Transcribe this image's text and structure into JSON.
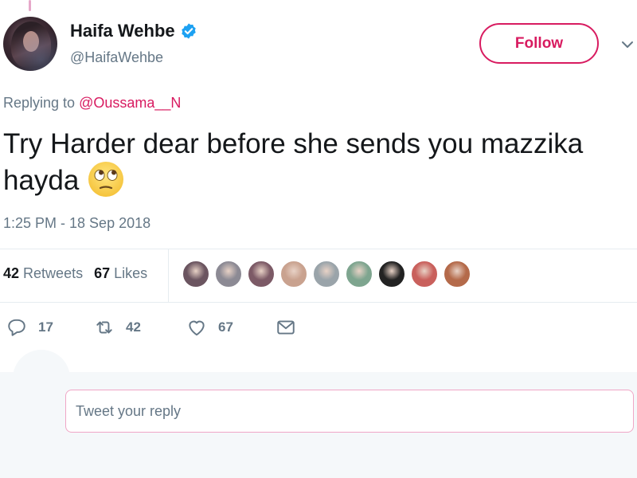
{
  "author": {
    "display_name": "Haifa Wehbe",
    "handle": "@HaifaWehbe",
    "verified": true
  },
  "follow_button": {
    "label": "Follow"
  },
  "reply_context": {
    "prefix": "Replying to ",
    "mention": "@Oussama__N"
  },
  "tweet": {
    "text": "Try Harder dear before she sends you mazzika hayda",
    "emoji": "face-with-rolling-eyes",
    "timestamp": "1:25 PM - 18 Sep 2018"
  },
  "stats": {
    "retweets_count": "42",
    "retweets_label": "Retweets",
    "likes_count": "67",
    "likes_label": "Likes"
  },
  "liker_avatars": [
    {
      "color": "#6b5560"
    },
    {
      "color": "#8c8a94"
    },
    {
      "color": "#7c5a66"
    },
    {
      "color": "#c9a28f"
    },
    {
      "color": "#9aa4aa"
    },
    {
      "color": "#7ea58f"
    },
    {
      "color": "#222222"
    },
    {
      "color": "#c9605c"
    },
    {
      "color": "#b46a4a"
    }
  ],
  "actions": {
    "reply_count": "17",
    "retweet_count": "42",
    "like_count": "67"
  },
  "reply_box": {
    "placeholder": "Tweet your reply"
  },
  "colors": {
    "accent": "#d81b60",
    "verified": "#1da1f2",
    "secondary_text": "#657786"
  }
}
